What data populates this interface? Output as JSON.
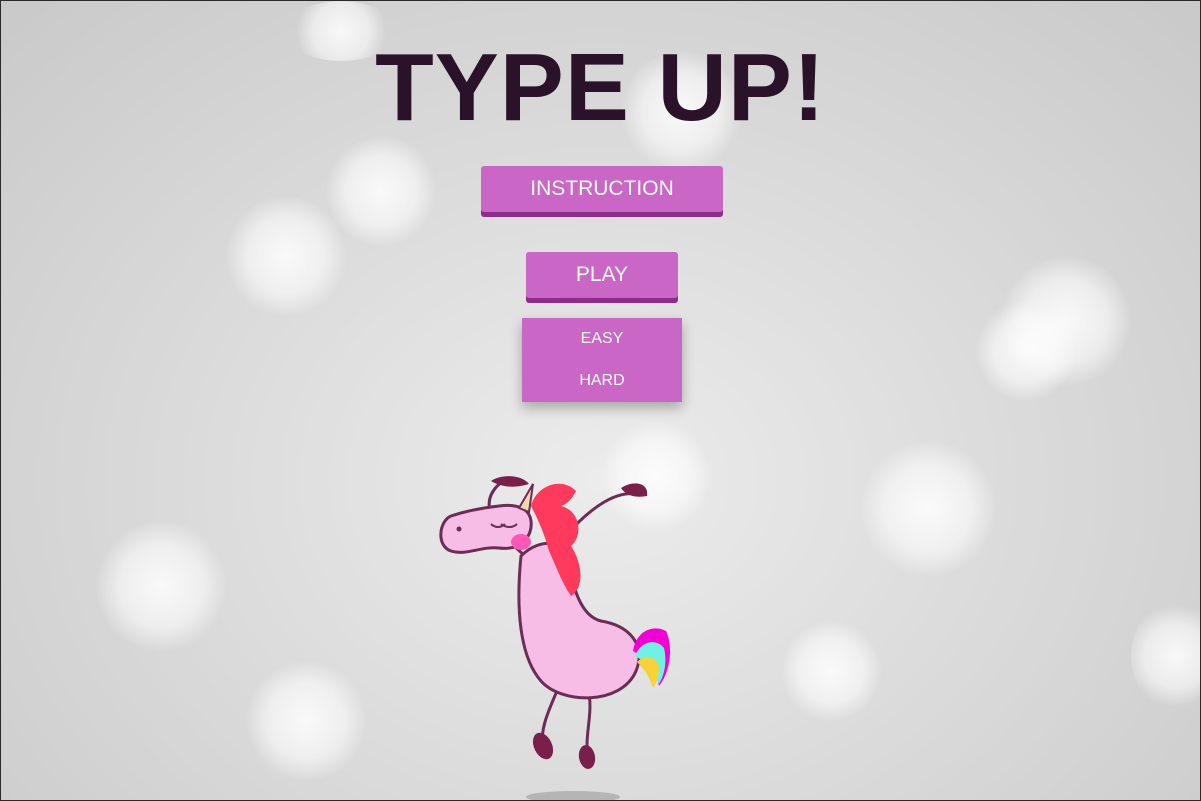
{
  "game": {
    "title": "TYPE UP!"
  },
  "buttons": {
    "instruction_label": "INSTRUCTION",
    "play_label": "PLAY"
  },
  "difficulty_menu": {
    "options": [
      {
        "label": "EASY"
      },
      {
        "label": "HARD"
      }
    ]
  },
  "colors": {
    "accent": "#c966c6",
    "accent_shadow": "#8e2b8b",
    "title": "#2a1328"
  },
  "mascot": {
    "icon": "dancing-unicorn-icon"
  }
}
